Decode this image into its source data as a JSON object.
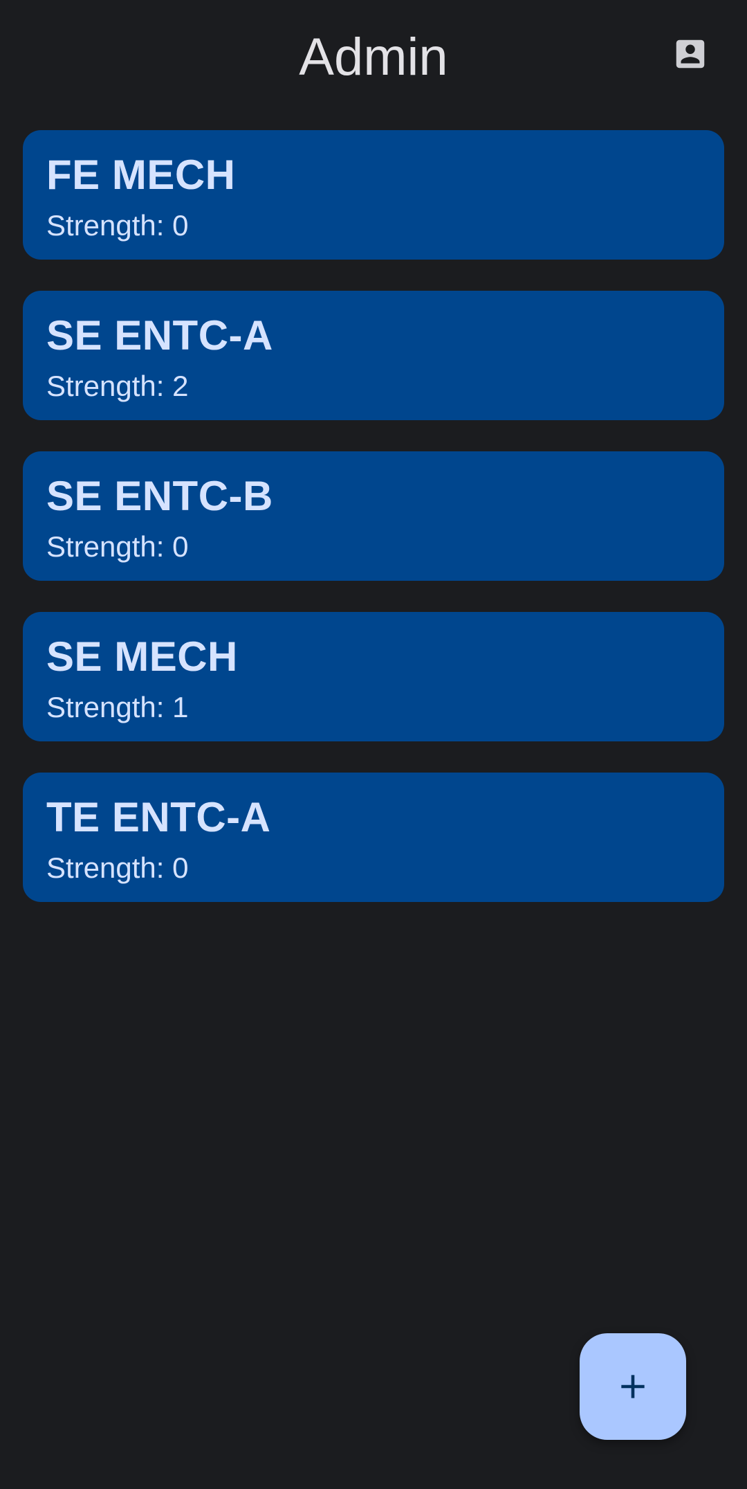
{
  "header": {
    "title": "Admin",
    "account_icon": "account-box-icon"
  },
  "classes": [
    {
      "name": "FE MECH",
      "strength": "Strength: 0"
    },
    {
      "name": "SE ENTC-A",
      "strength": "Strength: 2"
    },
    {
      "name": "SE ENTC-B",
      "strength": "Strength: 0"
    },
    {
      "name": "SE MECH",
      "strength": "Strength: 1"
    },
    {
      "name": "TE ENTC-A",
      "strength": "Strength: 0"
    }
  ],
  "fab": {
    "icon": "add-icon"
  },
  "colors": {
    "background": "#1b1c1f",
    "card": "#00468e",
    "card_text": "#d6e3ff",
    "fab": "#aac7ff",
    "title": "#e3e2e6"
  }
}
